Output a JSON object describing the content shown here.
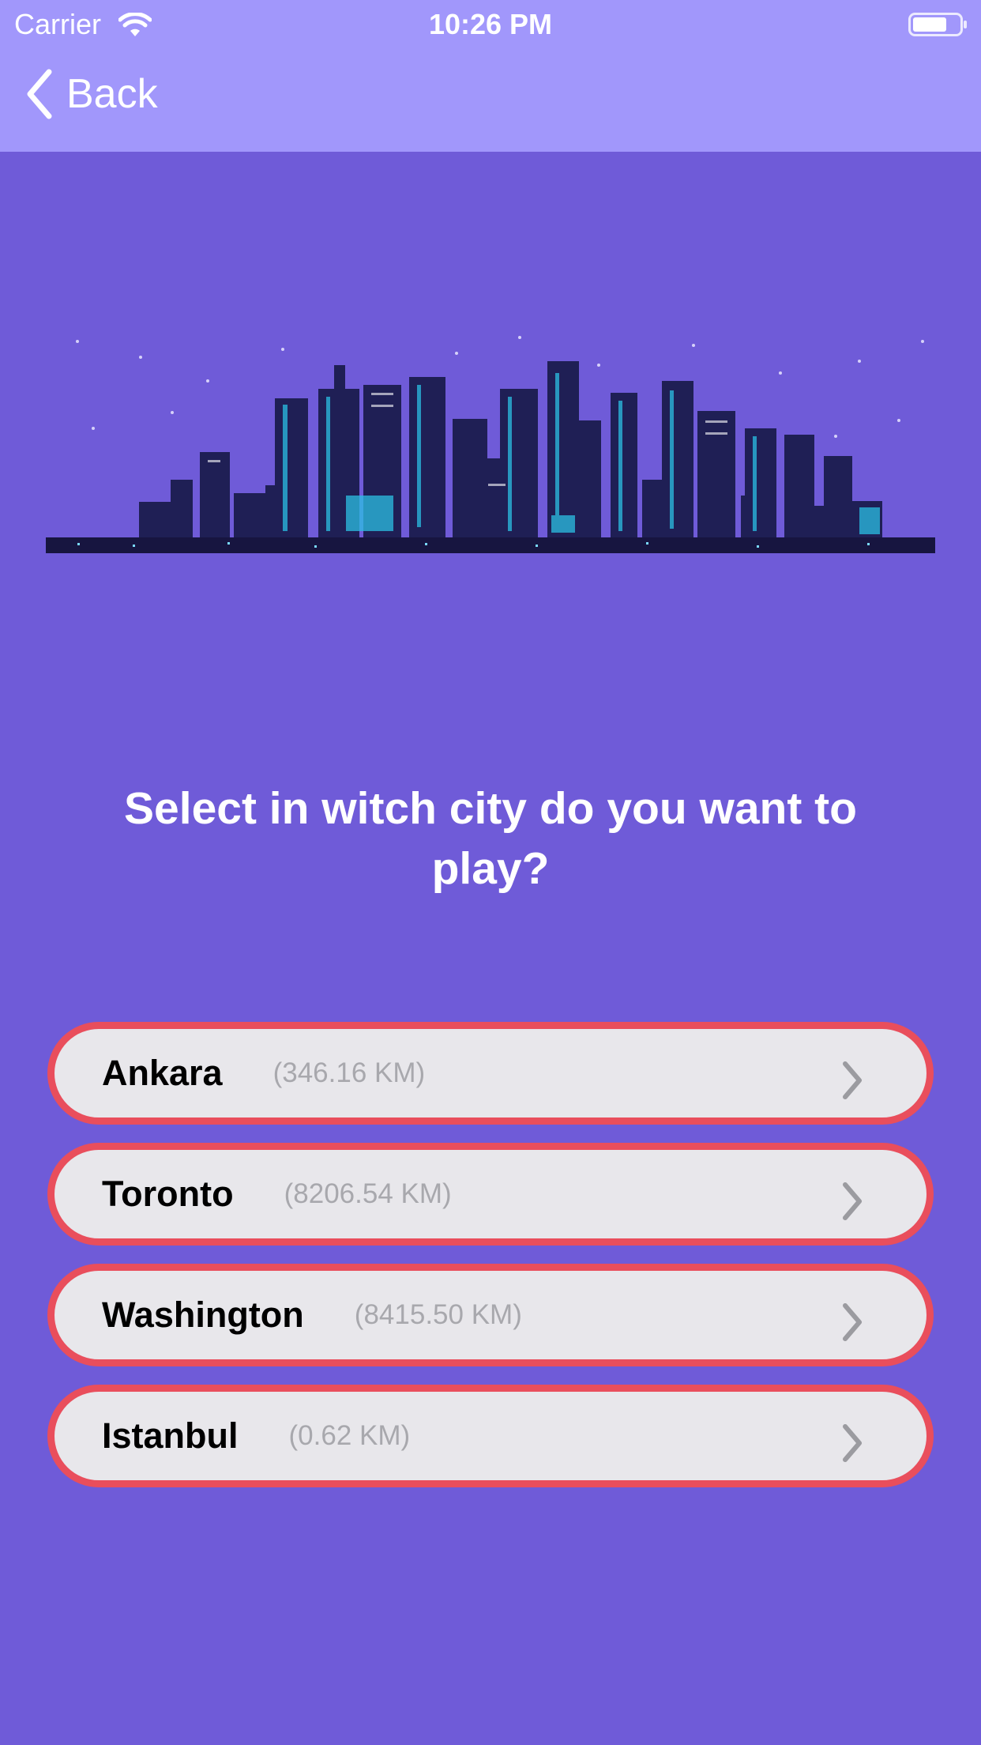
{
  "status_bar": {
    "carrier": "Carrier",
    "time": "10:26 PM"
  },
  "nav": {
    "back_label": "Back"
  },
  "main": {
    "prompt": "Select in witch city do you want to play?",
    "illustration_icon": "city-skyline-illustration"
  },
  "cities": [
    {
      "name": "Ankara",
      "distance": "(346.16 KM)"
    },
    {
      "name": "Toronto",
      "distance": "(8206.54 KM)"
    },
    {
      "name": "Washington",
      "distance": "(8415.50 KM)"
    },
    {
      "name": "Istanbul",
      "distance": "(0.62 KM)"
    }
  ],
  "colors": {
    "background": "#6f5bd8",
    "nav_bar": "#a197fb",
    "city_border": "#e94e5c",
    "city_fill": "#e8e7eb",
    "distance_text": "#a8a8ad"
  }
}
